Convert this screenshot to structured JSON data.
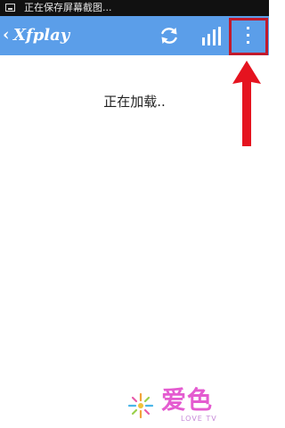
{
  "status_bar": {
    "text": "正在保存屏幕截图...",
    "icon": "screenshot-notification-icon"
  },
  "app_bar": {
    "back_symbol": "‹",
    "title": "Xfplay",
    "refresh_icon": "refresh-icon",
    "stats_icon": "bar-chart-icon",
    "more_icon": "overflow-menu-icon",
    "color": "#5b9ee9",
    "highlight_color": "#c21a2c"
  },
  "content": {
    "loading_text": "正在加载.."
  },
  "annotation": {
    "arrow_icon": "up-arrow-icon",
    "color": "#e5131f"
  },
  "watermark": {
    "chars": "爱色",
    "subtitle": "LOVE TV",
    "logo_icon": "flower-logo-icon"
  }
}
